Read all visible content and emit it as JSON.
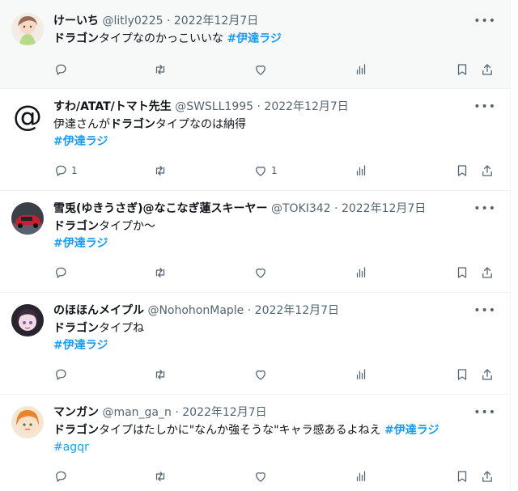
{
  "separator": "·",
  "more_glyph": "•••",
  "tweets": [
    {
      "name": "けーいち",
      "handle": "@litly0225",
      "date": "2022年12月7日",
      "text_bold": "ドラゴン",
      "text_rest": "タイプなのかっこいいな",
      "hashtag": "#伊達ラジ",
      "reply_count": "",
      "like_count": "",
      "avatar": "anime-girl-avatar"
    },
    {
      "name": "すわ/ATAT/トマト先生",
      "handle": "@SWSLL1995",
      "date": "2022年12月7日",
      "text_pre": "伊達さんが",
      "text_bold": "ドラゴン",
      "text_rest": "タイプなのは納得",
      "hashtag": "#伊達ラジ",
      "reply_count": "1",
      "like_count": "1",
      "avatar": "at-symbol-avatar",
      "avatar_glyph": "@"
    },
    {
      "name": "雪兎(ゆきうさぎ)@なこなぎ蓮スキーヤー",
      "handle": "@TOKI342",
      "date": "2022年12月7日",
      "text_bold": "ドラゴン",
      "text_rest": "タイプか〜",
      "hashtag": "#伊達ラジ",
      "reply_count": "",
      "like_count": "",
      "avatar": "red-car-avatar"
    },
    {
      "name": "のほほんメイプル",
      "handle": "@NohohonMaple",
      "date": "2022年12月7日",
      "text_bold": "ドラゴン",
      "text_rest": "タイプね",
      "hashtag": "#伊達ラジ",
      "reply_count": "",
      "like_count": "",
      "avatar": "anime-character-avatar"
    },
    {
      "name": "マンガン",
      "handle": "@man_ga_n",
      "date": "2022年12月7日",
      "text_bold": "ドラゴン",
      "text_rest": "タイプはたしかに\"なんか強そうな\"キャラ感あるよねえ",
      "hashtag": "#伊達ラジ",
      "hashtag2": "#agqr",
      "reply_count": "",
      "like_count": "",
      "avatar": "orange-hair-girl-avatar"
    }
  ],
  "colors": {
    "link": "#1d9bf0",
    "meta": "#536471",
    "highlight_bg": "#f7f9f9"
  },
  "icons": [
    "reply-icon",
    "retweet-icon",
    "like-icon",
    "views-icon",
    "bookmark-icon",
    "share-icon",
    "more-icon"
  ]
}
